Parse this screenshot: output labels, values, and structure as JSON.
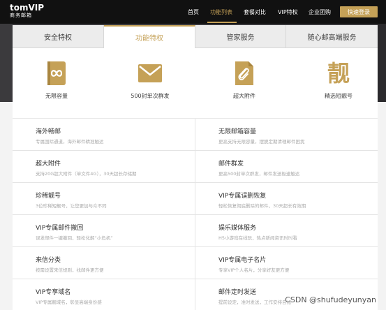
{
  "brand": {
    "logo_main": "tomVIP",
    "logo_sub": "商务邮箱"
  },
  "nav": {
    "items": [
      {
        "label": "首页"
      },
      {
        "label": "功能列表"
      },
      {
        "label": "套餐对比"
      },
      {
        "label": "VIP特权"
      },
      {
        "label": "企业团购"
      }
    ],
    "login": "快速登录"
  },
  "tabs": [
    {
      "label": "安全特权"
    },
    {
      "label": "功能特权"
    },
    {
      "label": "管家服务"
    },
    {
      "label": "随心邮高端服务"
    }
  ],
  "features": [
    {
      "icon": "infinity-icon",
      "label": "无限容量"
    },
    {
      "icon": "envelope-icon",
      "label": "500封单次群发"
    },
    {
      "icon": "paperclip-icon",
      "label": "超大附件"
    },
    {
      "icon": "liang-icon",
      "glyph": "靓",
      "label": "精选短靓号"
    }
  ],
  "services": [
    {
      "title": "海外畅邮",
      "desc": "专属国际通道，海外邮件精准触达"
    },
    {
      "title": "无限邮箱容量",
      "desc": "更高支持无限容量，摆脱定期清理邮件困扰"
    },
    {
      "title": "超大附件",
      "desc": "支持20G超大附件（单文件4G），30天超长存储期"
    },
    {
      "title": "邮件群发",
      "desc": "更高500封单次群发，邮件发送极速触达"
    },
    {
      "title": "珍稀靓号",
      "desc": "3位珍稀短靓号，让您更加与众不同"
    },
    {
      "title": "VIP专属误删恢复",
      "desc": "轻松恢复彻底删除的邮件，30天超长有效期"
    },
    {
      "title": "VIP专属邮件撤回",
      "desc": "误发邮件一键撤回，轻松化解“小危机”"
    },
    {
      "title": "娱乐媒体服务",
      "desc": "H5小游戏在线玩，热点新闻资讯时时看"
    },
    {
      "title": "来信分类",
      "desc": "按需设置来信规则，找邮件更方便"
    },
    {
      "title": "VIP专属电子名片",
      "desc": "专享VIP个人名片，分享好友更方便"
    },
    {
      "title": "VIP专享域名",
      "desc": "VIP专属靓域名，彰显高端身份感"
    },
    {
      "title": "邮件定时发送",
      "desc": "提前设定，准时发送，工作安排自如"
    }
  ],
  "watermark": "CSDN @shufudeyunyan",
  "colors": {
    "accent": "#c5a157",
    "nav_bg": "#111111",
    "banner": "#3b3a3d"
  }
}
